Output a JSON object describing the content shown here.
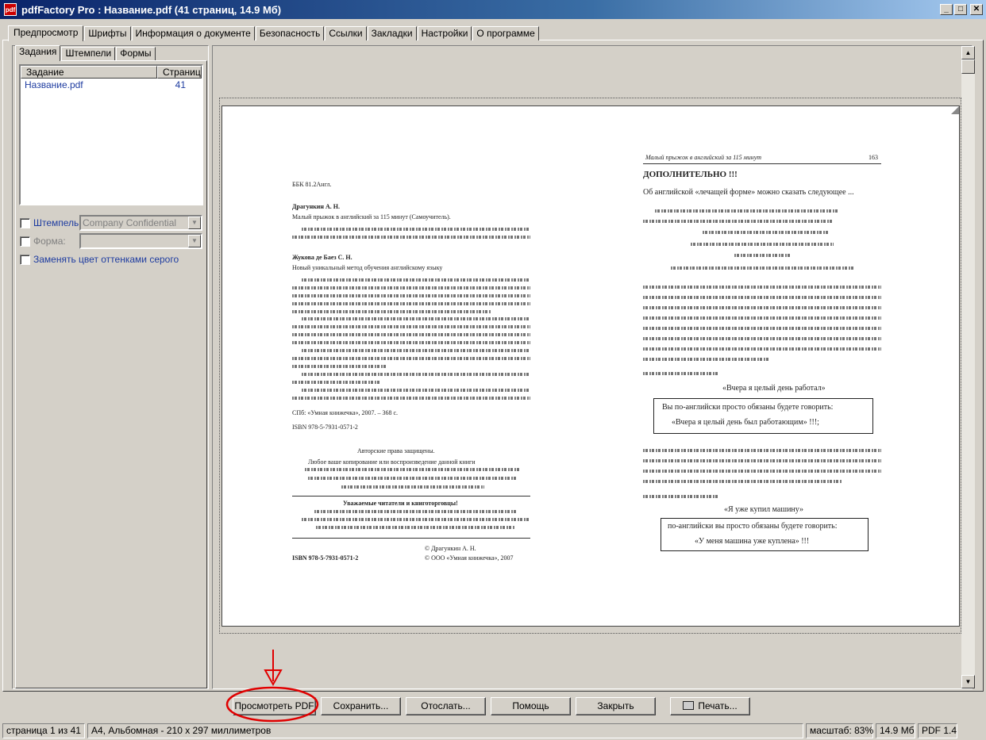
{
  "window": {
    "title": "pdfFactory Pro : Название.pdf (41 страниц, 14.9 Мб)",
    "icon_text": "pdf",
    "minimize": "_",
    "maximize": "□",
    "close": "✕"
  },
  "tabs": [
    "Предпросмотр",
    "Шрифты",
    "Информация о документе",
    "Безопасность",
    "Ссылки",
    "Закладки",
    "Настройки",
    "О программе"
  ],
  "sidebar": {
    "tabs": [
      "Задания",
      "Штемпели",
      "Формы"
    ],
    "list": {
      "headers": [
        "Задание",
        "Страниц"
      ],
      "rows": [
        {
          "name": "Название.pdf",
          "pages": "41"
        }
      ]
    },
    "stamps": {
      "label": "Штемпель:",
      "value": "Company Confidential"
    },
    "forms": {
      "label": "Форма:",
      "value": ""
    },
    "grayscale": {
      "label": "Заменять цвет оттенками серого"
    }
  },
  "page": {
    "left": {
      "bbk": "ББК 81.2Англ.",
      "author": "Драгункин А. Н.",
      "title": "Малый прыжок в английский за 115 минут (Самоучитель).",
      "author2": "Жукова де Баез С. Н.",
      "title2": "Новый уникальный метод обучения английскому языку",
      "publisher": "СПб: «Умная книжечка», 2007. – 368 с.",
      "isbn_small": "ISBN 978-5-7931-0571-2",
      "rights_head": "Авторские права защищены.",
      "rights_text": "Любое ваше копирование или воспроизведение данной книги",
      "notice": "Уважаемые читатели и книготорговцы!",
      "isbn": "ISBN 978-5-7931-0571-2",
      "copyright1": "© Драгункин А. Н.",
      "copyright2": "© ООО «Умная книжечка», 2007"
    },
    "right": {
      "header": "Малый прыжок в английский за 115 минут",
      "page_no": "163",
      "heading": "ДОПОЛНИТЕЛЬНО !!!",
      "intro": "Об английской «лечащей форме» можно сказать следующее ...",
      "example1": "«Вчера я целый день работал»",
      "box1_line1": "Вы по-английски просто обязаны будете говорить:",
      "box1_line2": "«Вчера я целый день был работающим» !!!;",
      "example2": "«Я уже купил машину»",
      "box2_line1": "по-английски вы просто обязаны будете говорить:",
      "box2_line2": "«У меня машина уже куплена» !!!"
    }
  },
  "buttons": [
    "Просмотреть PDF",
    "Сохранить...",
    "Отослать...",
    "Помощь",
    "Закрыть",
    "Печать..."
  ],
  "annotation": {
    "color": "#e00000"
  },
  "status": {
    "page": "страница 1 из 41",
    "format": "A4, Альбомная - 210 x 297 миллиметров",
    "zoom": "масштаб: 83%",
    "size": "14.9 Мб",
    "version": "PDF 1.4"
  }
}
